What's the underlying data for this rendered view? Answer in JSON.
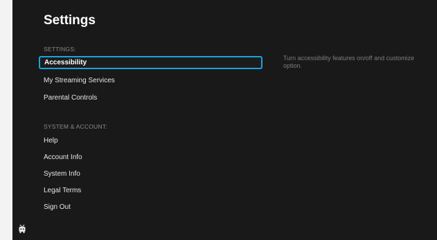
{
  "header": {
    "title": "Settings"
  },
  "sections": {
    "settings_label": "SETTINGS:",
    "system_label": "SYSTEM & ACCOUNT:"
  },
  "settings_items": [
    {
      "label": "Accessibility",
      "selected": true
    },
    {
      "label": "My Streaming Services"
    },
    {
      "label": "Parental Controls"
    }
  ],
  "system_items": [
    {
      "label": "Help"
    },
    {
      "label": "Account Info"
    },
    {
      "label": "System Info"
    },
    {
      "label": "Legal Terms"
    },
    {
      "label": "Sign Out"
    }
  ],
  "detail": {
    "description": "Turn accessibility features on/off and customize option."
  },
  "colors": {
    "background": "#191919",
    "focus_border": "#1aa3e0",
    "muted_text": "#8a8a8a"
  },
  "icons": {
    "bottom_left": "tv-icon"
  }
}
